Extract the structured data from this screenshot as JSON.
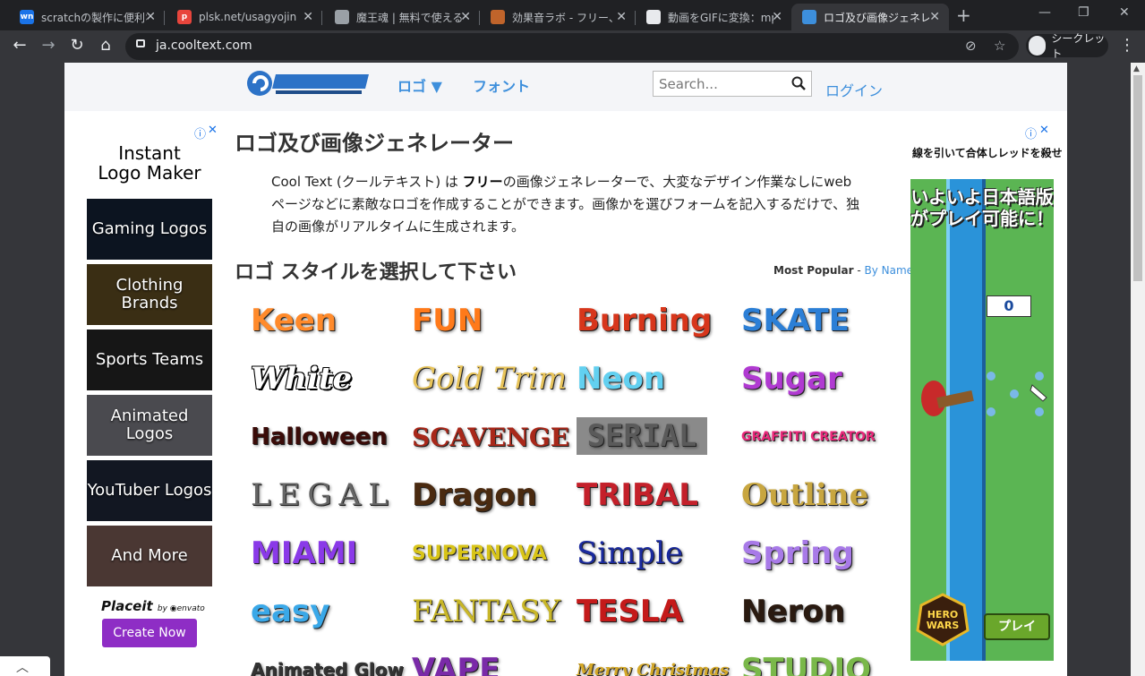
{
  "browser": {
    "tabs": [
      {
        "title": "scratchの製作に便利な",
        "favicon_text": "wn",
        "favicon_color": "#1a73e8"
      },
      {
        "title": "plsk.net/usagyojin",
        "favicon_text": "p",
        "favicon_color": "#e8453c"
      },
      {
        "title": "魔王魂 | 無料で使える",
        "favicon_text": "",
        "favicon_color": "#9aa0a6"
      },
      {
        "title": "効果音ラボ - フリー、商",
        "favicon_text": "",
        "favicon_color": "#c0642b"
      },
      {
        "title": "動画をGIFに変換：mp",
        "favicon_text": "",
        "favicon_color": "#e8eaed"
      },
      {
        "title": "ロゴ及び画像ジェネレー",
        "favicon_text": "",
        "favicon_color": "#3d8fdc"
      }
    ],
    "active_tab_index": 5,
    "url": "ja.cooltext.com",
    "incognito_label": "シークレット"
  },
  "header": {
    "nav_logo": "ロゴ ▼",
    "nav_font": "フォント",
    "search_placeholder": "Search...",
    "login": "ログイン"
  },
  "left_ad": {
    "title_line1": "Instant",
    "title_line2": "Logo Maker",
    "tiles": [
      {
        "label": "Gaming Logos",
        "bg": "#0c1420"
      },
      {
        "label": "Clothing Brands",
        "bg": "#3a2e14"
      },
      {
        "label": "Sports Teams",
        "bg": "#161616"
      },
      {
        "label": "Animated Logos",
        "bg": "#4a4a4f"
      },
      {
        "label": "YouTuber Logos",
        "bg": "#121722"
      },
      {
        "label": "And More",
        "bg": "#4a3733"
      }
    ],
    "placeit": "Placeit",
    "placeit_by": "by ◉envato",
    "cta": "Create Now"
  },
  "main": {
    "title": "ロゴ及び画像ジェネレーター",
    "intro_before": "Cool Text (クールテキスト) は ",
    "intro_bold": "フリー",
    "intro_after": "の画像ジェネレーターで、大変なデザイン作業なしにwebページなどに素敵なロゴを作成することができます。画像かを選びフォームを記入するだけで、独自の画像がリアルタイムに生成されます。",
    "subtitle": "ロゴ スタイルを選択して下さい",
    "sort_popular": "Most Popular",
    "sort_sep": " - ",
    "sort_name": "By Name"
  },
  "styles": [
    {
      "label": "Keen",
      "color": "#ff8a2b"
    },
    {
      "label": "FUN",
      "color": "#ff7a1a"
    },
    {
      "label": "Burning",
      "color": "#d7361b"
    },
    {
      "label": "SKATE",
      "color": "#2c7fd6"
    },
    {
      "label": "White",
      "color": "#ffffff"
    },
    {
      "label": "Gold Trim",
      "color": "#e8c45a"
    },
    {
      "label": "Neon",
      "color": "#62d0f0"
    },
    {
      "label": "Sugar",
      "color": "#b03ad1"
    },
    {
      "label": "Halloween",
      "color": "#3a0b08"
    },
    {
      "label": "SCAVENGE",
      "color": "#a8281a"
    },
    {
      "label": "SERIAL",
      "color": "#5a5a5a"
    },
    {
      "label": "GRAFFITI CREATOR",
      "color": "#e8287a"
    },
    {
      "label": "LEGAL",
      "color": "#666666"
    },
    {
      "label": "Dragon",
      "color": "#4a2a10"
    },
    {
      "label": "TRIBAL",
      "color": "#c4202a"
    },
    {
      "label": "Outline",
      "color": "#c8a640"
    },
    {
      "label": "MIAMI",
      "color": "#8a3ae8"
    },
    {
      "label": "SUPERNOVA",
      "color": "#d8c418"
    },
    {
      "label": "Simple",
      "color": "#1a2a9e"
    },
    {
      "label": "Spring",
      "color": "#a87ae8"
    },
    {
      "label": "easy",
      "color": "#3aa8e8"
    },
    {
      "label": "FANTASY",
      "color": "#c8b628"
    },
    {
      "label": "TESLA",
      "color": "#c41a1a"
    },
    {
      "label": "Neron",
      "color": "#2a1a10"
    },
    {
      "label": "Animated Glow",
      "color": "#333333"
    },
    {
      "label": "VAPE",
      "color": "#7a2aa8"
    },
    {
      "label": "Merry Christmas",
      "color": "#d4a828"
    },
    {
      "label": "STUDIO",
      "color": "#7ab84a"
    }
  ],
  "right_ad": {
    "text": "線を引いて合体しレッドを殺せ",
    "game_title_line1": "いよいよ日本語版",
    "game_title_line2": "がプレイ可能に！",
    "score": "0",
    "play": "プレイ",
    "brand_line1": "HERO",
    "brand_line2": "WARS"
  }
}
